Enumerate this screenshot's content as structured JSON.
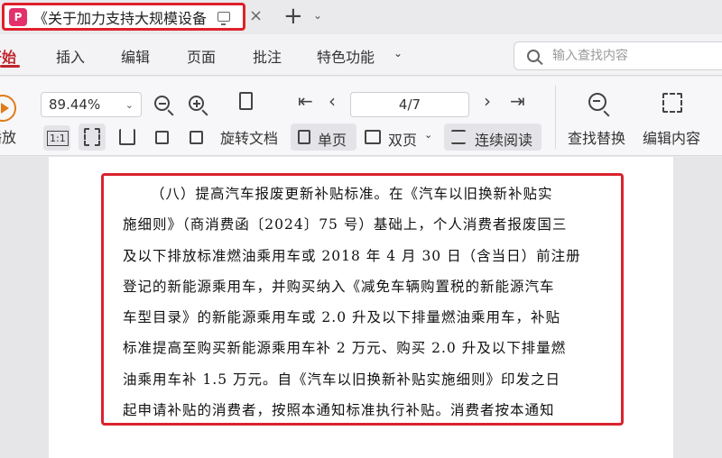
{
  "tab": {
    "title": "《关于加力支持大规模设备",
    "close": "×",
    "new_tab": "+",
    "dropdown": "⌄"
  },
  "menu": {
    "items": [
      "开始",
      "插入",
      "编辑",
      "页面",
      "批注",
      "特色功能"
    ],
    "active_first": "开始",
    "dropdown": "⌄"
  },
  "search": {
    "placeholder": "输入查找内容"
  },
  "toolbar": {
    "play_label": "播放",
    "zoom_value": "89.44%",
    "one_to_one": "1:1",
    "rotate_label": "旋转文档",
    "page_indicator": "4/7",
    "single_page": "单页",
    "double_page": "双页",
    "continuous": "连续阅读",
    "find_replace": "查找替换",
    "edit_content": "编辑内容"
  },
  "document": {
    "lines": [
      "（八）提高汽车报废更新补贴标准。在《汽车以旧换新补贴实",
      "施细则》（商消费函〔2024〕75 号）基础上，个人消费者报废国三",
      "及以下排放标准燃油乘用车或 2018 年 4 月 30 日（含当日）前注册",
      "登记的新能源乘用车，并购买纳入《减免车辆购置税的新能源汽车",
      "车型目录》的新能源乘用车或 2.0 升及以下排量燃油乘用车，补贴",
      "标准提高至购买新能源乘用车补 2 万元、购买 2.0 升及以下排量燃",
      "油乘用车补 1.5 万元。自《汽车以旧换新补贴实施细则》印发之日",
      "起申请补贴的消费者，按照本通知标准执行补贴。消费者按本通知"
    ]
  }
}
